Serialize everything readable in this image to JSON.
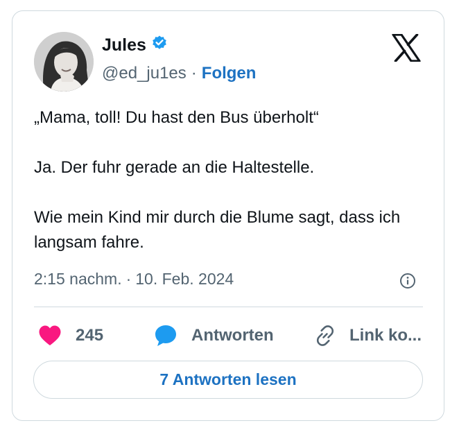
{
  "author": {
    "name": "Jules",
    "handle": "@ed_ju1es",
    "separator": "·",
    "follow_label": "Folgen",
    "verified": true
  },
  "tweet": {
    "paragraphs": [
      "„Mama, toll! Du hast den Bus überholt“",
      "Ja. Der fuhr gerade an die Haltestelle.",
      "Wie mein Kind mir durch die Blume sagt, dass ich langsam fahre."
    ]
  },
  "meta": {
    "time": "2:15 nachm.",
    "separator": "·",
    "date": "10. Feb. 2024"
  },
  "actions": {
    "like_count": "245",
    "reply_label": "Antworten",
    "copy_link_label": "Link ko..."
  },
  "read_replies_label": "7 Antworten lesen",
  "colors": {
    "like": "#f91880",
    "reply": "#1d9bf0",
    "link": "#1d72c2",
    "muted": "#536471",
    "border": "#cfd9de"
  },
  "icons": {
    "brand": "x-logo-icon",
    "verified": "verified-badge-icon",
    "info": "info-icon",
    "like": "heart-icon",
    "reply": "speech-bubble-icon",
    "copy_link": "chain-link-icon"
  }
}
